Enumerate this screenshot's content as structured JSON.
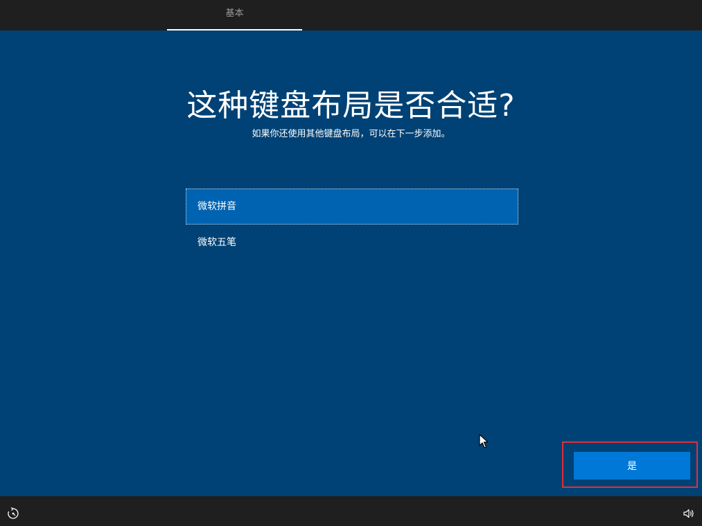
{
  "top_bar": {
    "tab_label": "基本"
  },
  "main": {
    "heading": "这种键盘布局是否合适?",
    "subheading": "如果你还使用其他键盘布局，可以在下一步添加。",
    "options": [
      {
        "label": "微软拼音",
        "selected": true
      },
      {
        "label": "微软五笔",
        "selected": false
      }
    ]
  },
  "actions": {
    "primary_label": "是"
  },
  "bottom_bar": {
    "left_icon": "ease-of-access-icon",
    "right_icon": "volume-icon"
  },
  "colors": {
    "background": "#004275",
    "selected_option": "#0063b1",
    "primary_button": "#0078d7",
    "highlight_border": "#e0303a",
    "bars": "#1f1f1f"
  }
}
